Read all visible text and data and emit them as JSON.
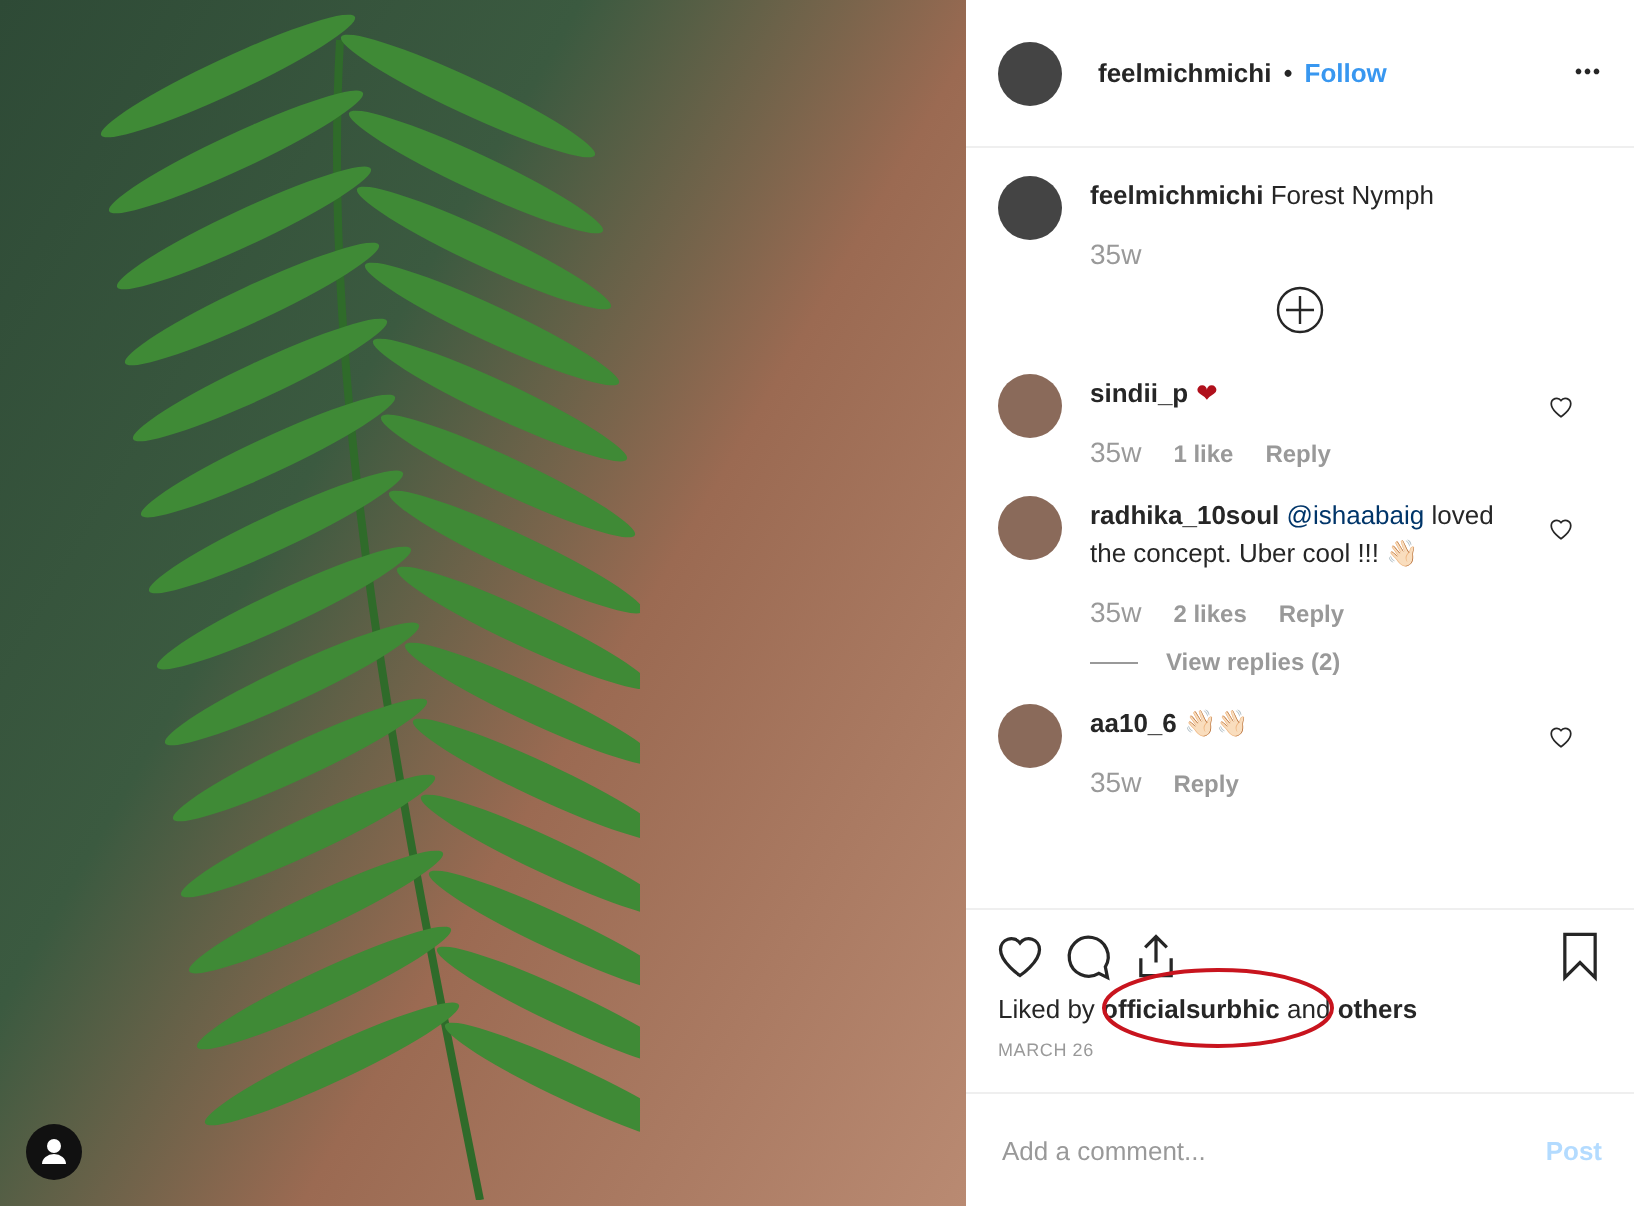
{
  "header": {
    "username": "feelmichmichi",
    "separator": "•",
    "follow": "Follow",
    "more": "•••"
  },
  "caption": {
    "username": "feelmichmichi",
    "text": "Forest Nymph",
    "time": "35w"
  },
  "comments": [
    {
      "username": "sindii_p",
      "text": "❤",
      "time": "35w",
      "likes": "1 like",
      "reply": "Reply"
    },
    {
      "username": "radhika_10soul",
      "mention": "@ishaabaig",
      "text": "loved the concept. Uber cool !!! 👋🏻",
      "time": "35w",
      "likes": "2 likes",
      "reply": "Reply",
      "view_replies": "View replies (2)"
    },
    {
      "username": "aa10_6",
      "text": "👋🏻👋🏻",
      "time": "35w",
      "reply": "Reply"
    }
  ],
  "likes": {
    "prefix": "Liked by",
    "user": "officialsurbhic",
    "middle": "and",
    "others": "others",
    "circled": true
  },
  "date": "MARCH 26",
  "comment_field": {
    "placeholder": "Add a comment...",
    "post": "Post"
  }
}
